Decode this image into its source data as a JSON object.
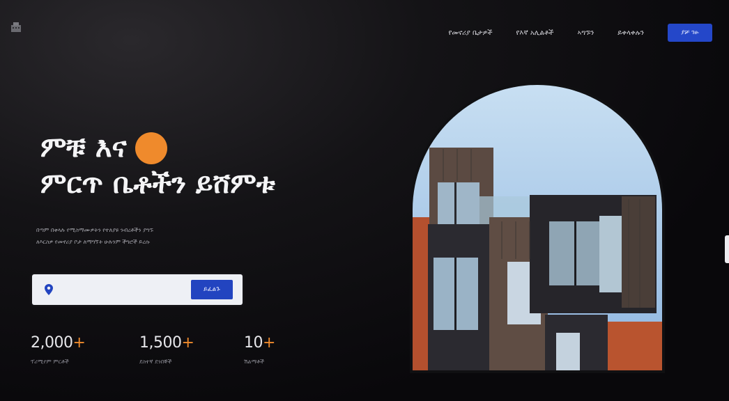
{
  "nav": {
    "items": [
      {
        "label": "የመኖሪያ ቤታዎች"
      },
      {
        "label": "የእኛ አሊልቶች"
      },
      {
        "label": "ኣግኙን"
      },
      {
        "label": "ይቀላቀሉን"
      }
    ],
    "cta_label": "ያቻ ገፁ"
  },
  "hero": {
    "title_line1": "ምቹ እና",
    "title_line2": "ምርጥ ቤቶችን ይሸምቱ",
    "subtitle_line1": "በጣም በቀላሉ የሚስማሙዎትን የተለያዩ ንብረቶችን ያግኙ",
    "subtitle_line2": "ለእርስዎ የመኖሪያ ቦታ ለማግኘት ሁሉንም ችግሮች ይረሱ"
  },
  "search": {
    "placeholder": "",
    "button_label": "ይፈልጉ"
  },
  "stats": [
    {
      "value": "2,000",
      "plus": "+",
      "label": "ፕሪሚየም ምርቶች"
    },
    {
      "value": "1,500",
      "plus": "+",
      "label": "ደስተኛ ደንበኞች"
    },
    {
      "value": "10",
      "plus": "+",
      "label": "ሽልማቶች"
    }
  ],
  "colors": {
    "accent": "#ef8a2c",
    "primary": "#2447c9",
    "background": "#0b0a0d"
  },
  "icons": {
    "logo": "building-logo-icon",
    "search_location": "location-pin-icon"
  }
}
